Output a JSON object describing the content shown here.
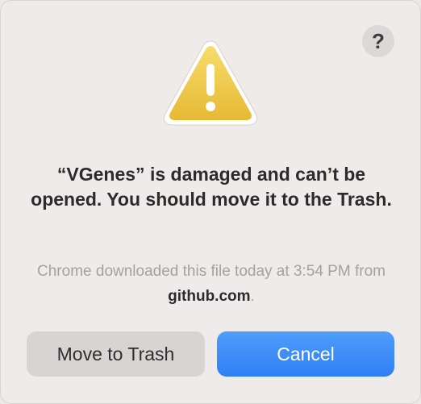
{
  "dialog": {
    "help_label": "?",
    "title": "“VGenes” is damaged and can’t be opened. You should move it to the Trash.",
    "message_prefix": "Chrome downloaded this file today at 3:54 PM from ",
    "message_domain": "github.com",
    "message_suffix": ".",
    "icon": "warning-triangle-icon",
    "buttons": {
      "move_to_trash": "Move to Trash",
      "cancel": "Cancel"
    },
    "colors": {
      "accent": "#3b8bf8",
      "warning": "#f0c640"
    }
  }
}
